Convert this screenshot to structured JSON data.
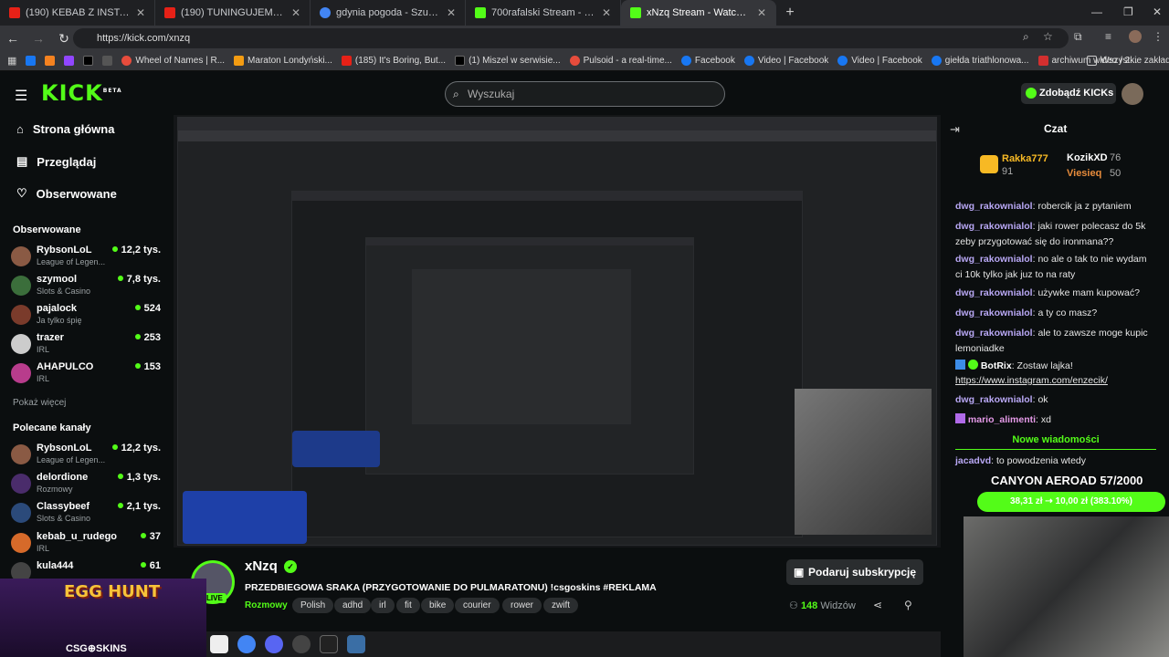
{
  "browser": {
    "tabs": [
      {
        "label": "(190) KEBAB Z INSTAGRAMA W",
        "color": "#e62117"
      },
      {
        "label": "(190) TUNINGUJEMY NASZEGO",
        "color": "#e62117"
      },
      {
        "label": "gdynia pogoda - Szukaj w Goo",
        "color": "#4285f4"
      },
      {
        "label": "700rafalski Stream - Watch Live",
        "color": "#53fc18"
      },
      {
        "label": "xNzq Stream - Watch Live on K",
        "color": "#53fc18"
      }
    ],
    "url": "https://kick.com/xnzq",
    "bookmarks": [
      {
        "label": "",
        "color": "#1877f2"
      },
      {
        "label": "",
        "color": "#f58220"
      },
      {
        "label": "",
        "color": "#9146ff"
      },
      {
        "label": "",
        "color": "#000000"
      },
      {
        "label": "",
        "color": "#555555"
      },
      {
        "label": "Wheel of Names | R...",
        "color": "#e74c3c"
      },
      {
        "label": "Maraton Londyński...",
        "color": "#f39c12"
      },
      {
        "label": "(185) It's Boring, But...",
        "color": "#e62117"
      },
      {
        "label": "(1) Miszel w serwisie...",
        "color": "#000000"
      },
      {
        "label": "Pulsoid - a real-time...",
        "color": "#e74c3c"
      },
      {
        "label": "Facebook",
        "color": "#1877f2"
      },
      {
        "label": "Video | Facebook",
        "color": "#1877f2"
      },
      {
        "label": "Video | Facebook",
        "color": "#1877f2"
      },
      {
        "label": "giełda triathlonowa...",
        "color": "#1877f2"
      },
      {
        "label": "archiwum wideo / 2...",
        "color": "#d32f2f"
      }
    ],
    "all_bookmarks": "Wszystkie zakładki"
  },
  "header": {
    "logo": "KICK",
    "logo_badge": "BETA",
    "search_placeholder": "Wyszukaj",
    "get_kicks": "Zdobądź KICKs"
  },
  "sidebar": {
    "nav": [
      "Strona główna",
      "Przeglądaj",
      "Obserwowane"
    ],
    "following_title": "Obserwowane",
    "following": [
      {
        "name": "RybsonLoL",
        "category": "League of Legen...",
        "viewers": "12,2 tys.",
        "color": "#8a5a44"
      },
      {
        "name": "szymool",
        "category": "Slots & Casino",
        "viewers": "7,8 tys.",
        "color": "#3b6e3b"
      },
      {
        "name": "pajalock",
        "category": "Ja tylko śpię",
        "viewers": "524",
        "color": "#7a3b2b"
      },
      {
        "name": "trazer",
        "category": "IRL",
        "viewers": "253",
        "color": "#cccccc"
      },
      {
        "name": "AHAPULCO",
        "category": "IRL",
        "viewers": "153",
        "color": "#b83c8c"
      }
    ],
    "show_more": "Pokaż więcej",
    "recommended_title": "Polecane kanały",
    "recommended": [
      {
        "name": "RybsonLoL",
        "category": "League of Legen...",
        "viewers": "12,2 tys.",
        "color": "#8a5a44"
      },
      {
        "name": "delordione",
        "category": "Rozmowy",
        "viewers": "1,3 tys.",
        "color": "#4a2c6b"
      },
      {
        "name": "Classybeef",
        "category": "Slots & Casino",
        "viewers": "2,1 tys.",
        "color": "#2b4a7a"
      },
      {
        "name": "kebab_u_rudego",
        "category": "IRL",
        "viewers": "37",
        "color": "#d66a2a"
      },
      {
        "name": "kula444",
        "category": "",
        "viewers": "61",
        "color": "#444444"
      }
    ]
  },
  "stream_info": {
    "channel": "xNzq",
    "live": "LIVE",
    "title": "PRZEDBIEGOWA SRAKA (PRZYGOTOWANIE DO PULMARATONU) !csgoskins #REKLAMA",
    "category": "Rozmowy",
    "tags": [
      "Polish",
      "adhd",
      "irl",
      "fit",
      "bike",
      "courier",
      "rower",
      "zwift"
    ],
    "subscribe": "Podaruj subskrypcję",
    "viewers": "148",
    "viewers_label": "Widzów"
  },
  "chat": {
    "title": "Czat",
    "leaderboard": [
      {
        "name": "Rakka777",
        "count": "91"
      },
      {
        "name": "KozikXD",
        "count": "76"
      },
      {
        "name": "Viesieq",
        "count": "50"
      }
    ],
    "messages": [
      {
        "user": "dwg_rakownialol",
        "text": "robercik ja z pytaniem"
      },
      {
        "user": "dwg_rakownialol",
        "text": "jaki rower polecasz do 5k zeby przygotować się do ironmana??"
      },
      {
        "user": "dwg_rakownialol",
        "text": "no ale o tak to nie wydam ci 10k tylko jak juz to na raty"
      },
      {
        "user": "dwg_rakownialol",
        "text": "używke mam kupować?"
      },
      {
        "user": "dwg_rakownialol",
        "text": "a ty co masz?"
      },
      {
        "user": "dwg_rakownialol",
        "text": "ale to zawsze moge kupic lemoniadke"
      },
      {
        "user": "BotRix",
        "text": "Zostaw lajka!"
      },
      {
        "user": "",
        "text": "https://www.instagram.com/enzecik/"
      },
      {
        "user": "dwg_rakownialol",
        "text": "ok"
      },
      {
        "user": "mario_alimenti",
        "text": "xd"
      },
      {
        "user": "jacadvd",
        "text": "to powodzenia wtedy"
      }
    ],
    "new_messages": "Nowe wiadomości",
    "overlay_title": "CANYON AEROAD 57/2000",
    "overlay_price": "38,31 zł ⇢ 10,00 zł (383.10%)"
  },
  "ad": {
    "title": "EGG HUNT",
    "brand": "CSG⊕SKINS"
  }
}
